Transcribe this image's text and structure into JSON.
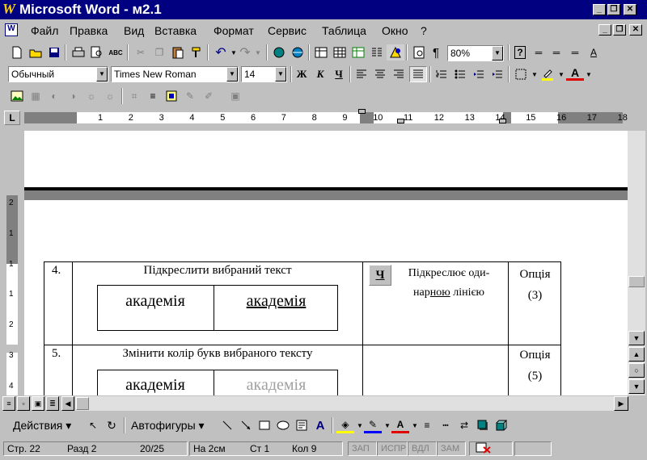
{
  "window": {
    "title": "Microsoft Word - м2.1",
    "logo": "W",
    "min": "_",
    "restore": "❐",
    "close": "✕"
  },
  "menu": [
    "Файл",
    "Правка",
    "Вид",
    "Вставка",
    "Формат",
    "Сервис",
    "Таблица",
    "Окно",
    "?"
  ],
  "toolbar": {
    "zoom": "80%",
    "style": "Обычный",
    "font": "Times New Roman",
    "size": "14",
    "bold": "Ж",
    "italic": "К",
    "underline": "Ч",
    "pilcrow": "¶",
    "help": "?"
  },
  "ruler": [
    "1",
    "2",
    "3",
    "4",
    "5",
    "6",
    "7",
    "8",
    "9",
    "10",
    "11",
    "12",
    "13",
    "14",
    "15",
    "16",
    "17",
    "18"
  ],
  "vruler": [
    "2",
    "1",
    "1",
    "1",
    "2",
    "3",
    "4"
  ],
  "table": {
    "rows": [
      {
        "num": "4.",
        "task": "Підкреслити вибраний текст",
        "left_sample": "академія",
        "right_sample": "академія",
        "button": "Ч",
        "desc_line1": "Підкреслює оди-",
        "desc_line2_pre": "нар",
        "desc_line2_u": "ною",
        "desc_line2_post": " лінією",
        "option1": "Опція",
        "option2": "(3)"
      },
      {
        "num": "5.",
        "task": "Змінити колір букв вибраного тексту",
        "left_sample": "академія",
        "right_sample": "академія",
        "option1": "Опція",
        "option2": "(5)"
      }
    ]
  },
  "drawing": {
    "actions": "Действия",
    "autoshapes": "Автофигуры"
  },
  "status": {
    "page": "Стр. 22",
    "section": "Разд 2",
    "pages": "20/25",
    "at": "На 2см",
    "line": "Ст 1",
    "col": "Кол 9",
    "rec": "ЗАП",
    "trk": "ИСПР",
    "ext": "ВДЛ",
    "ovr": "ЗАМ"
  },
  "colors": {
    "titlebar": "#000080",
    "face": "#c0c0c0",
    "grey_text": "#a0a0a0"
  }
}
